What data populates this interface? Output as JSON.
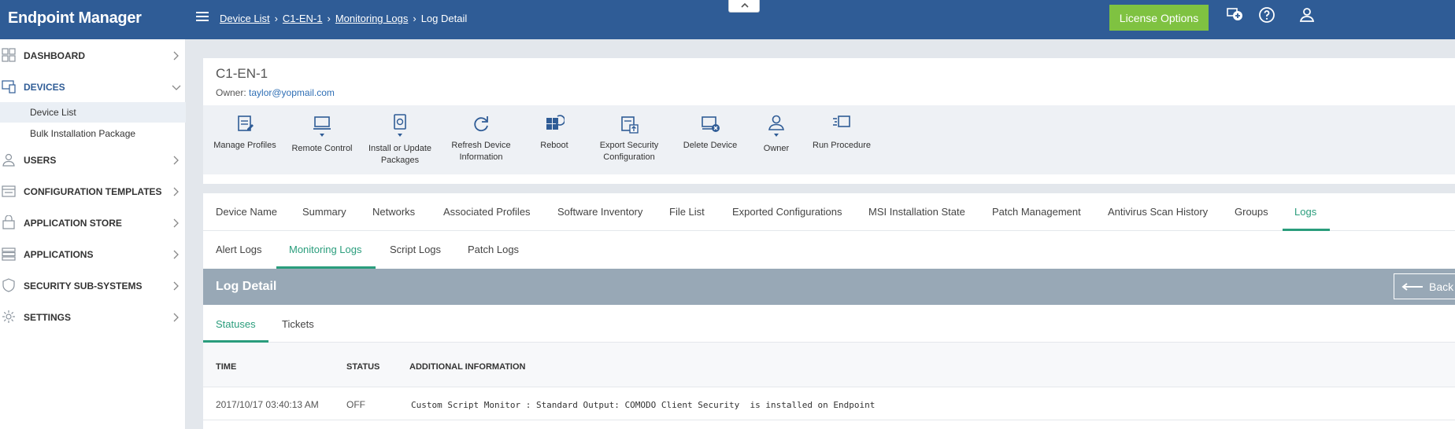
{
  "app": {
    "title": "Endpoint Manager"
  },
  "breadcrumb": {
    "items": [
      "Device List",
      "C1-EN-1",
      "Monitoring Logs",
      "Log Detail"
    ]
  },
  "header": {
    "license_label": "License Options"
  },
  "sidebar": {
    "items": [
      {
        "label": "DASHBOARD",
        "icon": "dashboard-icon"
      },
      {
        "label": "DEVICES",
        "icon": "devices-icon",
        "expanded": true
      },
      {
        "label": "USERS",
        "icon": "user-icon"
      },
      {
        "label": "CONFIGURATION TEMPLATES",
        "icon": "templates-icon"
      },
      {
        "label": "APPLICATION STORE",
        "icon": "store-icon"
      },
      {
        "label": "APPLICATIONS",
        "icon": "applications-icon"
      },
      {
        "label": "SECURITY SUB-SYSTEMS",
        "icon": "shield-icon"
      },
      {
        "label": "SETTINGS",
        "icon": "gear-icon"
      }
    ],
    "sub_items": [
      "Device List",
      "Bulk Installation Package"
    ]
  },
  "device": {
    "name": "C1-EN-1",
    "owner_label": "Owner:",
    "owner_email": "taylor@yopmail.com"
  },
  "toolbar": {
    "items": [
      {
        "label": "Manage Profiles"
      },
      {
        "label": "Remote Control"
      },
      {
        "label": "Install or Update Packages"
      },
      {
        "label": "Refresh Device Information"
      },
      {
        "label": "Reboot"
      },
      {
        "label": "Export Security Configuration"
      },
      {
        "label": "Delete Device"
      },
      {
        "label": "Owner"
      },
      {
        "label": "Run Procedure"
      }
    ]
  },
  "tabs": {
    "main": [
      "Device Name",
      "Summary",
      "Networks",
      "Associated Profiles",
      "Software Inventory",
      "File List",
      "Exported Configurations",
      "MSI Installation State",
      "Patch Management",
      "Antivirus Scan History",
      "Groups",
      "Logs"
    ],
    "main_active": "Logs",
    "sub": [
      "Alert Logs",
      "Monitoring Logs",
      "Script Logs",
      "Patch Logs"
    ],
    "sub_active": "Monitoring Logs"
  },
  "log_detail": {
    "title": "Log Detail",
    "back_label": "Back",
    "tabs": [
      "Statuses",
      "Tickets"
    ],
    "active_tab": "Statuses",
    "columns": [
      "TIME",
      "STATUS",
      "ADDITIONAL INFORMATION"
    ],
    "rows": [
      {
        "time": "2017/10/17 03:40:13 AM",
        "status": "OFF",
        "info": "Custom Script Monitor : Standard Output: COMODO Client Security  is installed on Endpoint"
      }
    ]
  },
  "colors": {
    "topbar": "#2f5c96",
    "accent": "#2a9d7c",
    "license": "#7fc241",
    "log_header": "#98a8b6"
  }
}
